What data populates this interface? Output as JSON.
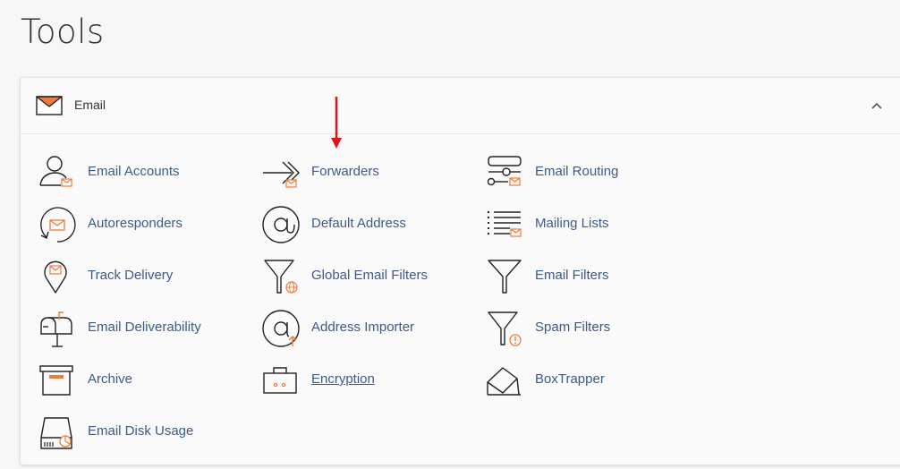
{
  "page": {
    "title": "Tools"
  },
  "panel": {
    "header": {
      "label": "Email",
      "icon": "envelope-icon",
      "collapse_icon": "chevron-up-icon"
    },
    "tools": [
      {
        "label": "Email Accounts",
        "icon": "email-accounts-icon"
      },
      {
        "label": "Forwarders",
        "icon": "forwarders-icon"
      },
      {
        "label": "Email Routing",
        "icon": "email-routing-icon"
      },
      {
        "label": "Autoresponders",
        "icon": "autoresponders-icon"
      },
      {
        "label": "Default Address",
        "icon": "at-sign-icon"
      },
      {
        "label": "Mailing Lists",
        "icon": "mailing-lists-icon"
      },
      {
        "label": "Track Delivery",
        "icon": "track-delivery-icon"
      },
      {
        "label": "Global Email Filters",
        "icon": "global-filter-icon"
      },
      {
        "label": "Email Filters",
        "icon": "filter-icon"
      },
      {
        "label": "Email Deliverability",
        "icon": "mailbox-icon"
      },
      {
        "label": "Address Importer",
        "icon": "address-importer-icon"
      },
      {
        "label": "Spam Filters",
        "icon": "spam-filter-icon"
      },
      {
        "label": "Archive",
        "icon": "archive-box-icon"
      },
      {
        "label": "Encryption",
        "icon": "encryption-briefcase-icon"
      },
      {
        "label": "BoxTrapper",
        "icon": "boxtrapper-icon"
      },
      {
        "label": "Email Disk Usage",
        "icon": "disk-usage-icon"
      }
    ]
  },
  "annotation": {
    "icon": "red-arrow-down-icon",
    "color": "#e0161a"
  },
  "colors": {
    "accent": "#ee7a3d",
    "link": "#3c5a8a",
    "icon_stroke": "#222222"
  }
}
